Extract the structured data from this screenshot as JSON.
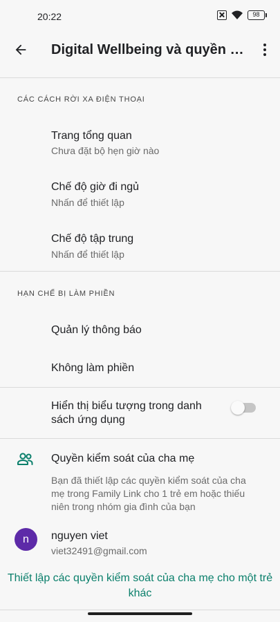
{
  "status_bar": {
    "time": "20:22",
    "battery": "98",
    "icons": [
      "sim-off-icon",
      "wifi-icon",
      "battery-icon"
    ]
  },
  "app_bar": {
    "title": "Digital Wellbeing và quyền ki...",
    "back_icon": "arrow-back-icon",
    "more_icon": "more-vert-icon"
  },
  "section_away": {
    "header": "CÁC CÁCH RỜI XA ĐIỆN THOẠI",
    "items": [
      {
        "title": "Trang tổng quan",
        "subtitle": "Chưa đặt bộ hẹn giờ nào"
      },
      {
        "title": "Chế độ giờ đi ngủ",
        "subtitle": "Nhấn để thiết lập"
      },
      {
        "title": "Chế độ tập trung",
        "subtitle": "Nhấn để thiết lập"
      }
    ]
  },
  "section_interruptions": {
    "header": "HẠN CHẾ BỊ LÀM PHIỀN",
    "items": [
      {
        "title": "Quản lý thông báo"
      },
      {
        "title": "Không làm phiền"
      }
    ]
  },
  "app_list_toggle": {
    "label": "Hiển thị biểu tượng trong danh sách ứng dụng",
    "checked": false
  },
  "parental": {
    "icon": "parental-controls-icon",
    "title": "Quyền kiểm soát của cha mẹ",
    "description": "Bạn đã thiết lập các quyền kiểm soát của cha mẹ trong Family Link cho 1 trẻ em hoặc thiếu niên trong nhóm gia đình của bạn",
    "account": {
      "avatar_letter": "n",
      "name": "nguyen viet",
      "email": "viet32491@gmail.com"
    },
    "setup_link": "Thiết lập các quyền kiểm soát của cha mẹ cho một trẻ khác"
  },
  "colors": {
    "accent": "#0a7f6b",
    "avatar": "#5d2aa8",
    "background": "#f7f7f7"
  }
}
